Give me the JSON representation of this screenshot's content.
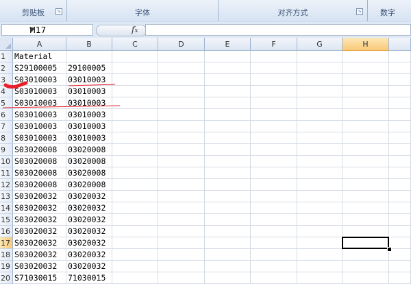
{
  "ribbon": {
    "groups": [
      {
        "label": "剪贴板"
      },
      {
        "label": "字体"
      },
      {
        "label": "对齐方式"
      },
      {
        "label": "数字"
      }
    ]
  },
  "formula_bar": {
    "name_box": "H17",
    "fx_icon": "fx-icon",
    "formula": ""
  },
  "sheet": {
    "columns": [
      "A",
      "B",
      "C",
      "D",
      "E",
      "F",
      "G",
      "H"
    ],
    "selected_column": "H",
    "selected_row": "17",
    "active_cell": "H17",
    "rows": [
      {
        "n": "1",
        "a": "Material",
        "b": ""
      },
      {
        "n": "2",
        "a": "S29100005",
        "b": "29100005"
      },
      {
        "n": "3",
        "a": "S03010003",
        "b": "03010003"
      },
      {
        "n": "4",
        "a": "S03010003",
        "b": "03010003"
      },
      {
        "n": "5",
        "a": "S03010003",
        "b": "03010003"
      },
      {
        "n": "6",
        "a": "S03010003",
        "b": "03010003"
      },
      {
        "n": "7",
        "a": "S03010003",
        "b": "03010003"
      },
      {
        "n": "8",
        "a": "S03010003",
        "b": "03010003"
      },
      {
        "n": "9",
        "a": "S03020008",
        "b": "03020008"
      },
      {
        "n": "10",
        "a": "S03020008",
        "b": "03020008"
      },
      {
        "n": "11",
        "a": "S03020008",
        "b": "03020008"
      },
      {
        "n": "12",
        "a": "S03020008",
        "b": "03020008"
      },
      {
        "n": "13",
        "a": "S03020032",
        "b": "03020032"
      },
      {
        "n": "14",
        "a": "S03020032",
        "b": "03020032"
      },
      {
        "n": "15",
        "a": "S03020032",
        "b": "03020032"
      },
      {
        "n": "16",
        "a": "S03020032",
        "b": "03020032"
      },
      {
        "n": "17",
        "a": "S03020032",
        "b": "03020032"
      },
      {
        "n": "18",
        "a": "S03020032",
        "b": "03020032"
      },
      {
        "n": "19",
        "a": "S03020032",
        "b": "03020032"
      },
      {
        "n": "20",
        "a": "S71030015",
        "b": "71030015"
      }
    ]
  },
  "colors": {
    "annotation": "#e8202a",
    "selected_header": "#f9c97a"
  }
}
